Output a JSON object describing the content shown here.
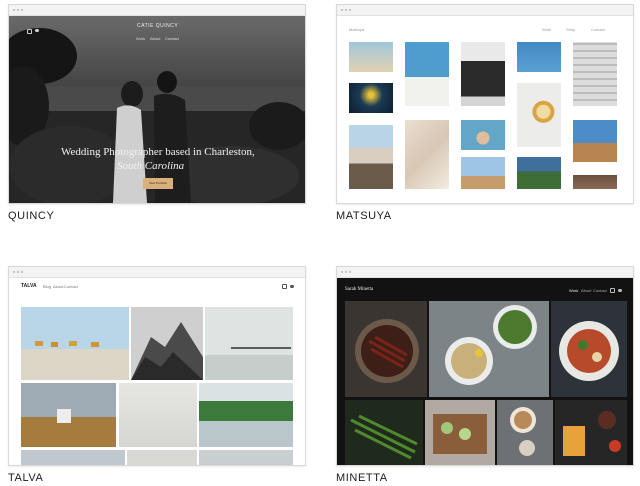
{
  "themes": [
    {
      "name": "QUINCY",
      "site_title": "CATIE QUINCY",
      "nav": [
        "Work",
        "About",
        "Contact"
      ],
      "headline_line1": "Wedding Photographer based in Charleston,",
      "headline_line2": "South Carolina",
      "cta": "View Portfolio"
    },
    {
      "name": "MATSUYA",
      "site_title": "Matsuya",
      "nav": [
        "Work",
        "Shop",
        "Contact"
      ]
    },
    {
      "name": "TALVA",
      "site_title": "TALVA",
      "nav": [
        "Blog",
        "About",
        "Contact"
      ]
    },
    {
      "name": "MINETTA",
      "site_title": "Sarah Minetta",
      "nav": [
        "Work",
        "About",
        "Contact"
      ]
    }
  ],
  "colors": {
    "quincy_cta": "#d9b07c",
    "minetta_bg": "#121212",
    "caption_text": "#1b1b1b"
  },
  "icons": [
    "instagram-icon",
    "twitter-icon"
  ]
}
